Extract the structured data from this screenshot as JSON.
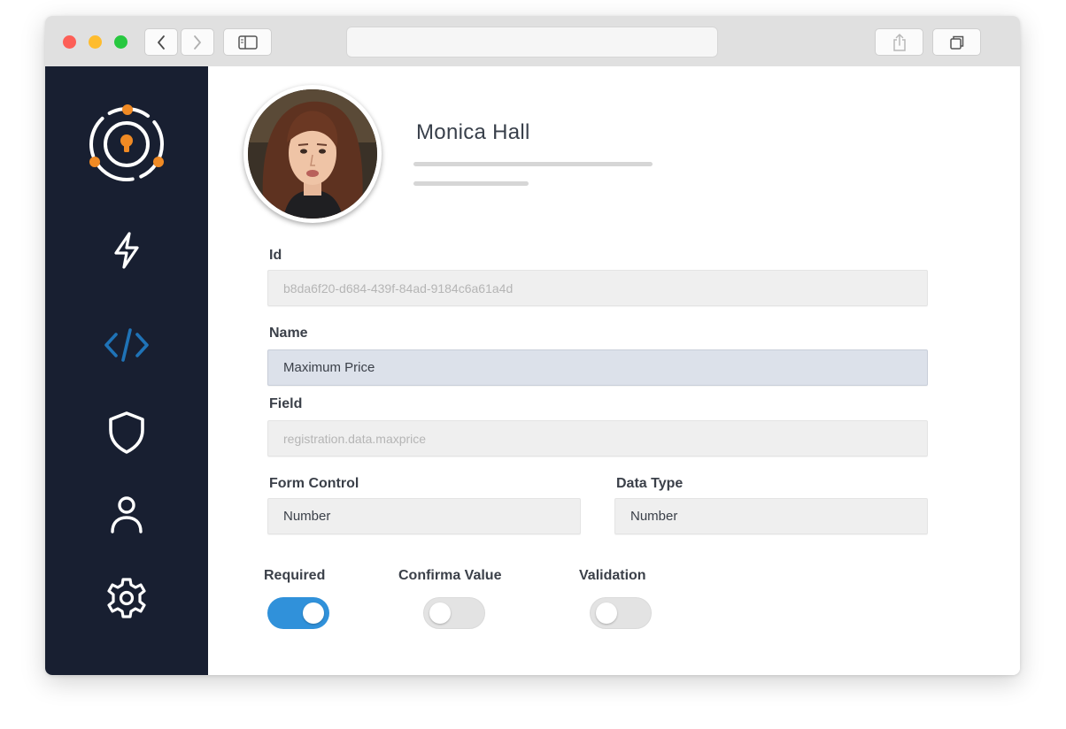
{
  "sidebar": {
    "items": [
      {
        "icon": "brand-logo-icon",
        "active": false
      },
      {
        "icon": "lightning-icon",
        "active": false
      },
      {
        "icon": "code-icon",
        "active": true
      },
      {
        "icon": "shield-icon",
        "active": false
      },
      {
        "icon": "user-icon",
        "active": false
      },
      {
        "icon": "gear-icon",
        "active": false
      }
    ],
    "active_color": "#1f73b7",
    "accent_color": "#f08a24"
  },
  "profile": {
    "name": "Monica Hall"
  },
  "form": {
    "id_label": "Id",
    "id_value": "b8da6f20-d684-439f-84ad-9184c6a61a4d",
    "name_label": "Name",
    "name_value": "Maximum Price",
    "field_label": "Field",
    "field_value": "registration.data.maxprice",
    "form_control_label": "Form Control",
    "form_control_value": "Number",
    "data_type_label": "Data Type",
    "data_type_value": "Number"
  },
  "toggles": {
    "required_label": "Required",
    "required_on": true,
    "confirm_label": "Confirma Value",
    "confirm_on": false,
    "validation_label": "Validation",
    "validation_on": false
  },
  "colors": {
    "sidebar_bg": "#181f31",
    "toggle_on": "#3091da"
  }
}
